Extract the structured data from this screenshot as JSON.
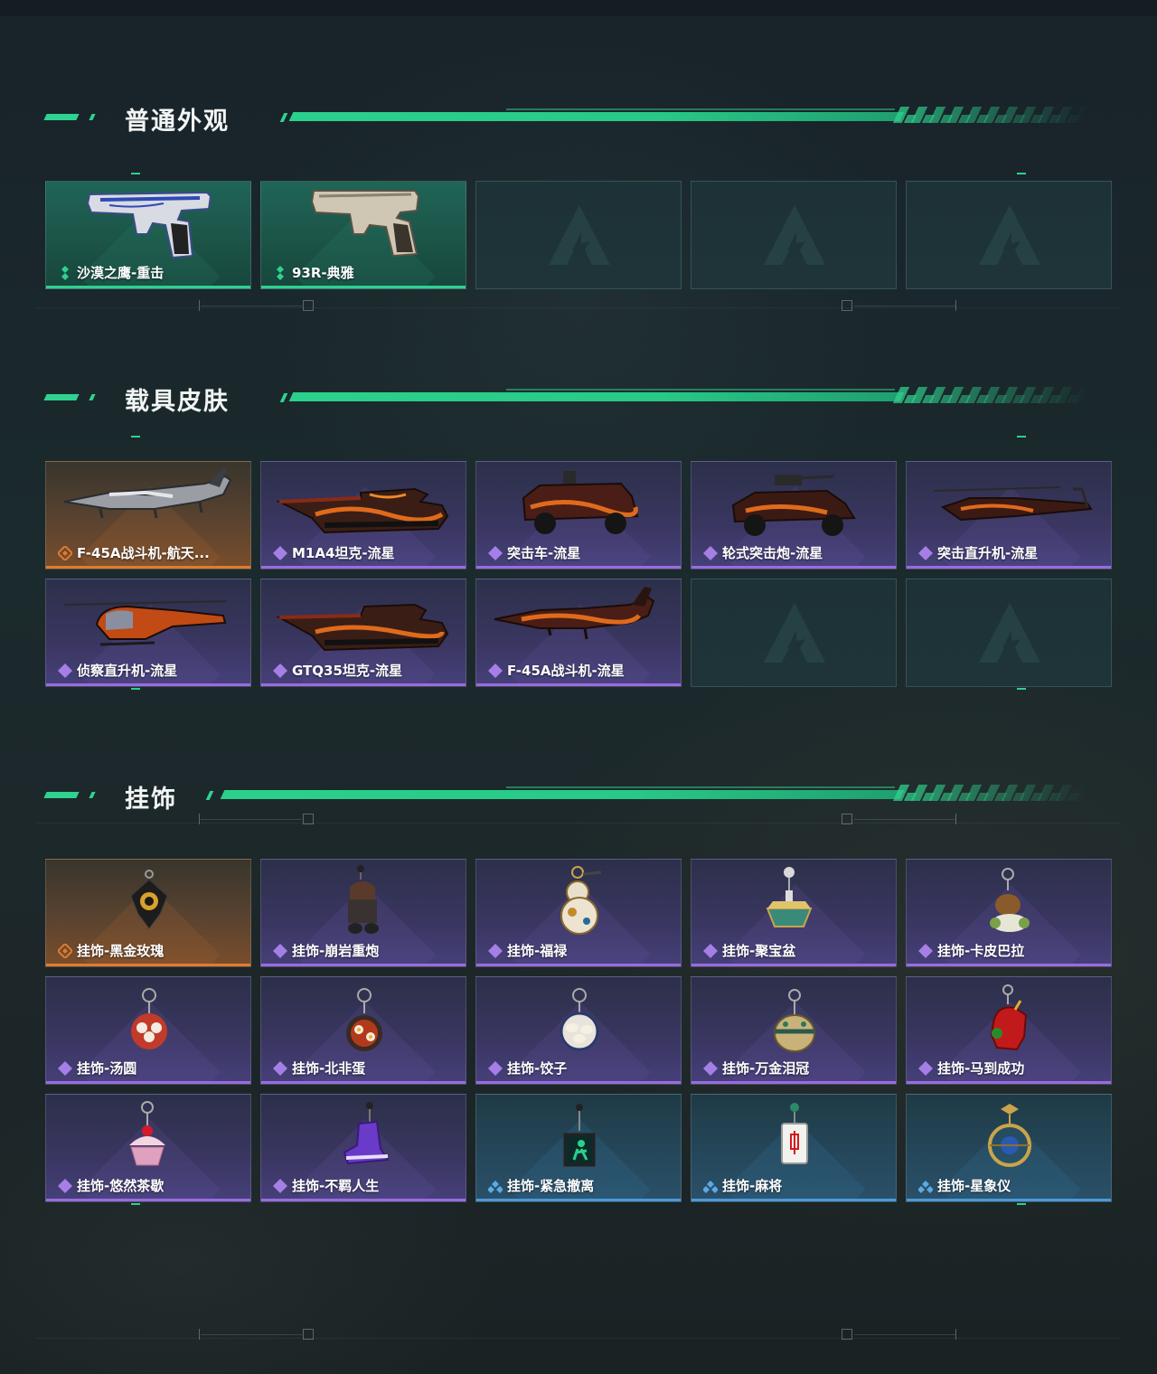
{
  "sections": [
    {
      "title": "普通外观",
      "items": [
        {
          "label": "沙漠之鹰-重击",
          "rarity": "green",
          "icon": "desert-eagle-pistol-icon"
        },
        {
          "label": "93R-典雅",
          "rarity": "green",
          "icon": "93r-pistol-icon"
        },
        {
          "label": "",
          "rarity": "empty"
        },
        {
          "label": "",
          "rarity": "empty"
        },
        {
          "label": "",
          "rarity": "empty"
        }
      ]
    },
    {
      "title": "载具皮肤",
      "items": [
        {
          "label": "F-45A战斗机-航天...",
          "rarity": "orange",
          "icon": "fighter-jet-icon"
        },
        {
          "label": "M1A4坦克-流星",
          "rarity": "purple",
          "icon": "tank-icon"
        },
        {
          "label": "突击车-流星",
          "rarity": "purple",
          "icon": "assault-vehicle-icon"
        },
        {
          "label": "轮式突击炮-流星",
          "rarity": "purple",
          "icon": "wheeled-assault-gun-icon"
        },
        {
          "label": "突击直升机-流星",
          "rarity": "purple",
          "icon": "attack-helicopter-icon"
        },
        {
          "label": "侦察直升机-流星",
          "rarity": "purple",
          "icon": "scout-helicopter-icon"
        },
        {
          "label": "GTQ35坦克-流星",
          "rarity": "purple",
          "icon": "tank-icon"
        },
        {
          "label": "F-45A战斗机-流星",
          "rarity": "purple",
          "icon": "fighter-jet-icon"
        },
        {
          "label": "",
          "rarity": "empty"
        },
        {
          "label": "",
          "rarity": "empty"
        }
      ]
    },
    {
      "title": "挂饰",
      "items": [
        {
          "label": "挂饰-黑金玫瑰",
          "rarity": "orange",
          "icon": "black-gold-rose-charm-icon"
        },
        {
          "label": "挂饰-崩岩重炮",
          "rarity": "purple",
          "icon": "figure-charm-icon"
        },
        {
          "label": "挂饰-福禄",
          "rarity": "purple",
          "icon": "gourd-charm-icon"
        },
        {
          "label": "挂饰-聚宝盆",
          "rarity": "purple",
          "icon": "treasure-bowl-charm-icon"
        },
        {
          "label": "挂饰-卡皮巴拉",
          "rarity": "purple",
          "icon": "capybara-charm-icon"
        },
        {
          "label": "挂饰-汤圆",
          "rarity": "purple",
          "icon": "tangyuan-charm-icon"
        },
        {
          "label": "挂饰-北非蛋",
          "rarity": "purple",
          "icon": "shakshuka-charm-icon"
        },
        {
          "label": "挂饰-饺子",
          "rarity": "purple",
          "icon": "dumpling-charm-icon"
        },
        {
          "label": "挂饰-万金泪冠",
          "rarity": "purple",
          "icon": "crown-charm-icon"
        },
        {
          "label": "挂饰-马到成功",
          "rarity": "purple",
          "icon": "red-horse-charm-icon"
        },
        {
          "label": "挂饰-悠然茶歇",
          "rarity": "purple",
          "icon": "cupcake-charm-icon"
        },
        {
          "label": "挂饰-不羁人生",
          "rarity": "purple",
          "icon": "sneaker-charm-icon"
        },
        {
          "label": "挂饰-紧急撤离",
          "rarity": "blue",
          "icon": "exit-sign-charm-icon"
        },
        {
          "label": "挂饰-麻将",
          "rarity": "blue",
          "icon": "mahjong-tile-charm-icon"
        },
        {
          "label": "挂饰-星象仪",
          "rarity": "blue",
          "icon": "astrolabe-charm-icon"
        }
      ]
    }
  ],
  "colors": {
    "green": "#2ed190",
    "purple": "#9a6bdf",
    "orange": "#e07b30",
    "blue": "#4a9ad8",
    "accent": "#2fd38f"
  }
}
